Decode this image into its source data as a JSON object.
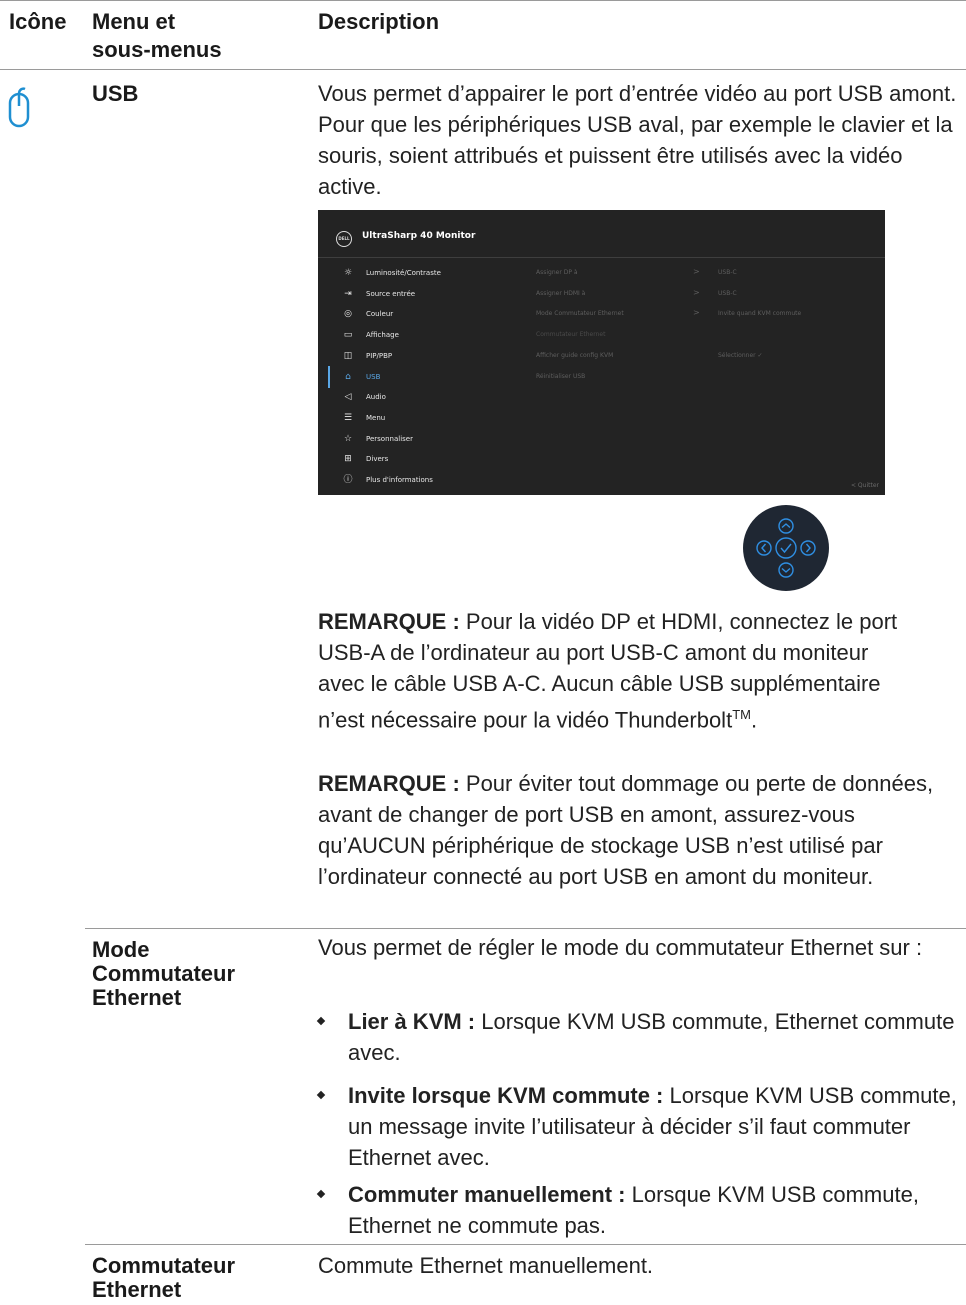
{
  "header": {
    "col_icon": "Icône",
    "col_menu": "Menu et\nsous-menus",
    "col_desc": "Description"
  },
  "usb": {
    "icon": "mouse-icon",
    "menu": "USB",
    "desc": "Vous permet d’appairer le port d’entrée vidéo au port USB amont. Pour que les périphériques USB aval, par exemple le clavier et la souris, soient attribués et puissent être utilisés avec la vidéo active.",
    "note1_label": "REMARQUE :",
    "note1": " Pour la vidéo DP et HDMI, connectez le port USB-A de l’ordinateur au port USB-C amont du moniteur avec le câble USB A-C. Aucun câble USB supplémentaire n’est nécessaire pour la vidéo Thunderbolt",
    "note1_tm": "TM",
    "note1_end": ".",
    "note2_label": "REMARQUE :",
    "note2": " Pour éviter tout dommage ou perte de données, avant de changer de port USB en amont, assurez-vous qu’AUCUN périphérique de stockage USB n’est utilisé par l’ordinateur connecté au port USB en amont du moniteur."
  },
  "osd": {
    "logo": "DELL",
    "title": "UltraSharp 40 Monitor",
    "items": [
      {
        "icon": "☼",
        "label": "Luminosité/Contraste"
      },
      {
        "icon": "⇥",
        "label": "Source entrée"
      },
      {
        "icon": "◎",
        "label": "Couleur"
      },
      {
        "icon": "▭",
        "label": "Affichage"
      },
      {
        "icon": "◫",
        "label": "PIP/PBP"
      },
      {
        "icon": "⌂",
        "label": "USB"
      },
      {
        "icon": "◁",
        "label": "Audio"
      },
      {
        "icon": "☰",
        "label": "Menu"
      },
      {
        "icon": "☆",
        "label": "Personnaliser"
      },
      {
        "icon": "⊞",
        "label": "Divers"
      },
      {
        "icon": "ⓘ",
        "label": "Plus d'informations"
      }
    ],
    "active_index": 5,
    "options": [
      {
        "label": "Assigner DP à",
        "arrow": ">",
        "value": "USB-C"
      },
      {
        "label": "Assigner HDMI à",
        "arrow": ">",
        "value": "USB-C"
      },
      {
        "label": "Mode Commutateur Ethernet",
        "arrow": ">",
        "value": "Invite quand KVM commute"
      },
      {
        "label": "Commutateur Ethernet",
        "arrow": "",
        "value": ""
      },
      {
        "label": "Afficher guide config KVM",
        "arrow": "",
        "value": "Sélectionner ✓"
      },
      {
        "label": "Réinitialiser USB",
        "arrow": "",
        "value": ""
      }
    ],
    "exit": "< Quitter"
  },
  "joystick": {
    "icon": "joystick-icon"
  },
  "ethernet_mode": {
    "menu": "Mode\nCommutateur\nEthernet",
    "desc": "Vous permet de régler le mode du commutateur Ethernet sur :",
    "bullets": [
      {
        "label": "Lier à KVM :",
        "text": " Lorsque KVM USB commute, Ethernet commute avec."
      },
      {
        "label": "Invite lorsque KVM commute :",
        "text": " Lorsque KVM USB commute, un message invite l’utilisateur à décider s’il faut commuter Ethernet avec."
      },
      {
        "label": "Commuter manuellement :",
        "text": " Lorsque KVM USB commute, Ethernet ne commute pas."
      }
    ]
  },
  "ethernet_switch": {
    "menu": "Commutateur\nEthernet",
    "desc": "Commute Ethernet manuellement."
  }
}
